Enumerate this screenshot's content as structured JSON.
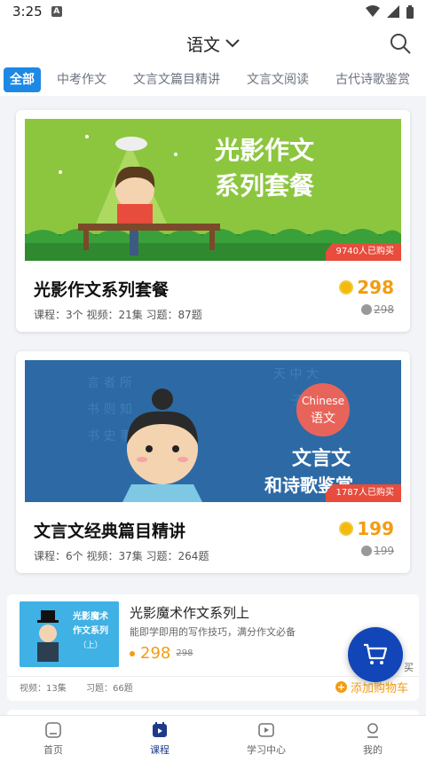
{
  "status": {
    "time": "3:25"
  },
  "header": {
    "title": "语文"
  },
  "tabs": [
    "全部",
    "中考作文",
    "文言文篇目精讲",
    "文言文阅读",
    "古代诗歌鉴赏"
  ],
  "courses": [
    {
      "banner_text_line1": "光影作文",
      "banner_text_line2": "系列套餐",
      "buyers": "9740人已购买",
      "title": "光影作文系列套餐",
      "meta": "课程：3个   视频：21集   习题：87题",
      "price": "298",
      "orig_price": "298"
    },
    {
      "banner_bubble_line1": "Chinese",
      "banner_bubble_line2": "语文",
      "banner_text_line1": "文言文",
      "banner_text_line2": "和诗歌鉴赏",
      "buyers": "1787人已购买",
      "title": "文言文经典篇目精讲",
      "meta": "课程：6个   视频：37集   习题：264题",
      "price": "199",
      "orig_price": "199"
    }
  ],
  "small_course": {
    "thumb_line1": "光影魔术",
    "thumb_line2": "作文系列",
    "thumb_line3": "（上）",
    "title": "光影魔术作文系列上",
    "desc": "能即学即用的写作技巧，满分作文必备",
    "price": "298",
    "orig_price": "298",
    "partial": "买",
    "videos": "视频：13集",
    "exercises": "习题：66题",
    "add_cart": "添加购物车"
  },
  "bottom_nav": [
    {
      "label": "首页",
      "icon": "home-icon"
    },
    {
      "label": "课程",
      "icon": "calendar-icon"
    },
    {
      "label": "学习中心",
      "icon": "play-icon"
    },
    {
      "label": "我的",
      "icon": "user-icon"
    }
  ],
  "colors": {
    "accent": "#1e88e5",
    "price": "#f39c12",
    "fab": "#1246b8",
    "badge": "#e74c3c"
  }
}
